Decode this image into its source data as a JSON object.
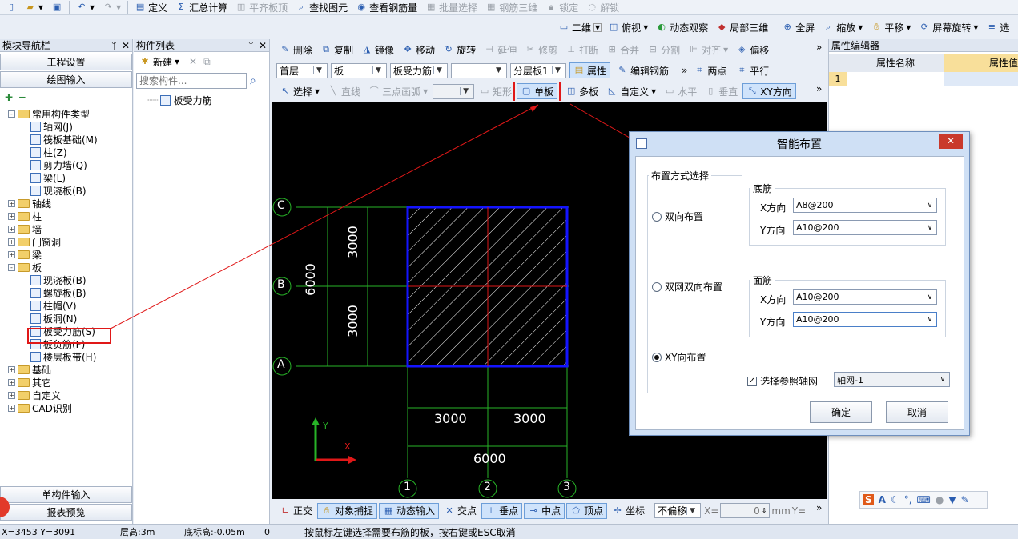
{
  "top_toolbar": {
    "define": "定义",
    "sum_calc": "汇总计算",
    "flat_top": "平齐板顶",
    "find_elem": "查找图元",
    "view_rebar_qty": "查看钢筋量",
    "batch_select": "批量选择",
    "rebar_3d": "钢筋三维",
    "lock": "锁定",
    "unlock": "解锁"
  },
  "view_toolbar": {
    "view_mode": "二维",
    "top_view": "俯视",
    "dynamic_view": "动态观察",
    "local_3d": "局部三维",
    "fullscreen": "全屏",
    "zoom": "缩放",
    "pan": "平移",
    "screen_rotate": "屏幕旋转",
    "select_tail": "选"
  },
  "module_nav": {
    "title": "模块导航栏",
    "project_settings": "工程设置",
    "drawing_input": "绘图输入",
    "tree": [
      {
        "label": "常用构件类型",
        "level": 0,
        "type": "folder",
        "exp": "-"
      },
      {
        "label": "轴网(J)",
        "level": 1,
        "type": "leaf"
      },
      {
        "label": "筏板基础(M)",
        "level": 1,
        "type": "leaf"
      },
      {
        "label": "柱(Z)",
        "level": 1,
        "type": "leaf"
      },
      {
        "label": "剪力墙(Q)",
        "level": 1,
        "type": "leaf"
      },
      {
        "label": "梁(L)",
        "level": 1,
        "type": "leaf"
      },
      {
        "label": "现浇板(B)",
        "level": 1,
        "type": "leaf"
      },
      {
        "label": "轴线",
        "level": 0,
        "type": "folder",
        "exp": "+"
      },
      {
        "label": "柱",
        "level": 0,
        "type": "folder",
        "exp": "+"
      },
      {
        "label": "墙",
        "level": 0,
        "type": "folder",
        "exp": "+"
      },
      {
        "label": "门窗洞",
        "level": 0,
        "type": "folder",
        "exp": "+"
      },
      {
        "label": "梁",
        "level": 0,
        "type": "folder",
        "exp": "+"
      },
      {
        "label": "板",
        "level": 0,
        "type": "folder",
        "exp": "-"
      },
      {
        "label": "现浇板(B)",
        "level": 1,
        "type": "leaf"
      },
      {
        "label": "螺旋板(B)",
        "level": 1,
        "type": "leaf"
      },
      {
        "label": "柱帽(V)",
        "level": 1,
        "type": "leaf"
      },
      {
        "label": "板洞(N)",
        "level": 1,
        "type": "leaf"
      },
      {
        "label": "板受力筋(S)",
        "level": 1,
        "type": "leaf",
        "highlight": true
      },
      {
        "label": "板负筋(F)",
        "level": 1,
        "type": "leaf"
      },
      {
        "label": "楼层板带(H)",
        "level": 1,
        "type": "leaf"
      },
      {
        "label": "基础",
        "level": 0,
        "type": "folder",
        "exp": "+"
      },
      {
        "label": "其它",
        "level": 0,
        "type": "folder",
        "exp": "+"
      },
      {
        "label": "自定义",
        "level": 0,
        "type": "folder",
        "exp": "+"
      },
      {
        "label": "CAD识别",
        "level": 0,
        "type": "folder",
        "exp": "+"
      }
    ],
    "single_input": "单构件输入",
    "report_preview": "报表预览"
  },
  "component_list": {
    "title": "构件列表",
    "new_button": "新建",
    "search_placeholder": "搜索构件...",
    "items": [
      "板受力筋"
    ]
  },
  "edit_toolbar": {
    "delete": "删除",
    "copy": "复制",
    "mirror": "镜像",
    "move": "移动",
    "rotate": "旋转",
    "extend": "延伸",
    "trim": "修剪",
    "break": "打断",
    "merge": "合并",
    "split": "分割",
    "align": "对齐",
    "offset": "偏移"
  },
  "prop_toolbar": {
    "floor": "首层",
    "category": "板",
    "type": "板受力筋",
    "blank": "",
    "layer": "分层板1",
    "attribute": "属性",
    "edit_rebar": "编辑钢筋",
    "two_points": "两点",
    "parallel": "平行"
  },
  "draw_toolbar": {
    "select": "选择",
    "line": "直线",
    "arc3": "三点画弧",
    "rect": "矩形",
    "single_slab": "单板",
    "multi_slab": "多板",
    "custom": "自定义",
    "horizontal": "水平",
    "vertical": "垂直",
    "xy_dir": "XY方向"
  },
  "property_editor": {
    "title": "属性编辑器",
    "col_name": "属性名称",
    "col_value": "属性值",
    "row_num": "1"
  },
  "drawing": {
    "axis_rows": [
      "C",
      "B",
      "A"
    ],
    "axis_cols": [
      "1",
      "2",
      "3"
    ],
    "dim_left_total": "6000",
    "dim_left_upper": "3000",
    "dim_left_lower": "3000",
    "dim_bottom_left": "3000",
    "dim_bottom_right": "3000",
    "dim_bottom_total": "6000",
    "ucs_x": "X",
    "ucs_y": "Y"
  },
  "dialog": {
    "title": "智能布置",
    "layout_group": "布置方式选择",
    "opt_double": "双向布置",
    "opt_double_net": "双网双向布置",
    "opt_xy": "XY向布置",
    "bottom_group": "底筋",
    "top_group": "面筋",
    "x_dir": "X方向",
    "y_dir": "Y方向",
    "bottom_x_value": "A8@200",
    "bottom_y_value": "A10@200",
    "top_x_value": "A10@200",
    "top_y_value": "A10@200",
    "ref_axis_label": "选择参照轴网",
    "ref_axis_value": "轴网-1",
    "ok": "确定",
    "cancel": "取消"
  },
  "snap_toolbar": {
    "ortho": "正交",
    "osnap": "对象捕捉",
    "dyn_input": "动态输入",
    "intersect": "交点",
    "perp": "垂点",
    "midpoint": "中点",
    "vertex": "顶点",
    "coord": "坐标",
    "no_offset": "不偏移",
    "x_label": "X=",
    "x_value": "0",
    "unit": "mm",
    "y_label": "Y="
  },
  "status_bar": {
    "coords": "X=3453 Y=3091",
    "floor_height": "层高:3m",
    "base_height": "底标高:-0.05m",
    "zero": "0",
    "hint": "按鼠标左键选择需要布筋的板，按右键或ESC取消"
  },
  "colors": {
    "highlight_red": "#e01818",
    "grid_green": "#27b327",
    "slab_blue": "#1414ff",
    "canvas_bg": "#000000"
  }
}
